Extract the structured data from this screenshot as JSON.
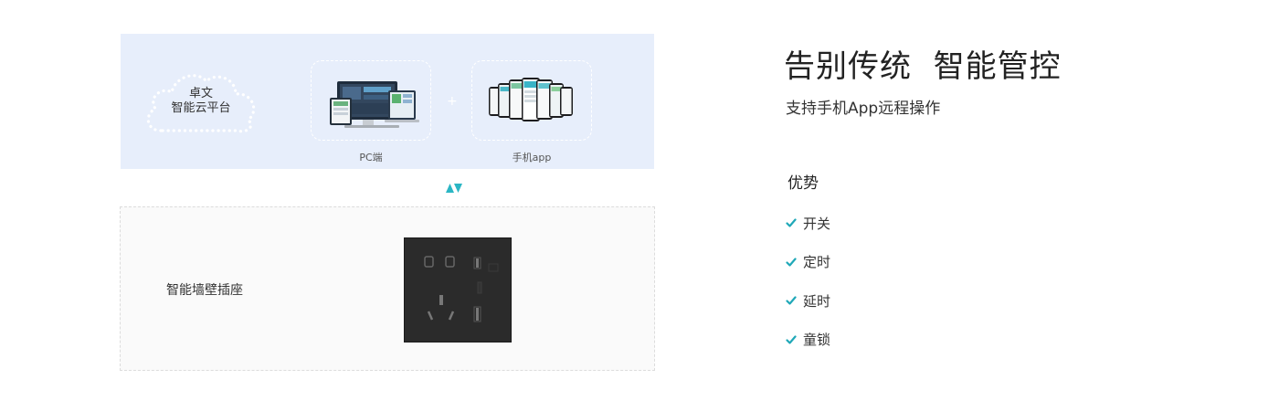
{
  "platform": {
    "cloud_line1": "卓文",
    "cloud_line2": "智能云平台",
    "plus": "+",
    "pc_label": "PC端",
    "app_label": "手机app"
  },
  "socket": {
    "label": "智能墙壁插座"
  },
  "hero": {
    "headline": "告别传统  智能管控",
    "subline": "支持手机App远程操作"
  },
  "advantages": {
    "title": "优势",
    "items": [
      {
        "label": "开关"
      },
      {
        "label": "定时"
      },
      {
        "label": "延时"
      },
      {
        "label": "童锁"
      }
    ]
  },
  "colors": {
    "accent_check": "#1fa8b8",
    "arrow": "#2bb6c4",
    "panel_bg": "#e7eefb"
  },
  "icons": [
    "cloud-icon",
    "laptop-monitor-icon",
    "phones-icon",
    "sync-arrows-icon",
    "wall-socket-image",
    "check-icon"
  ]
}
